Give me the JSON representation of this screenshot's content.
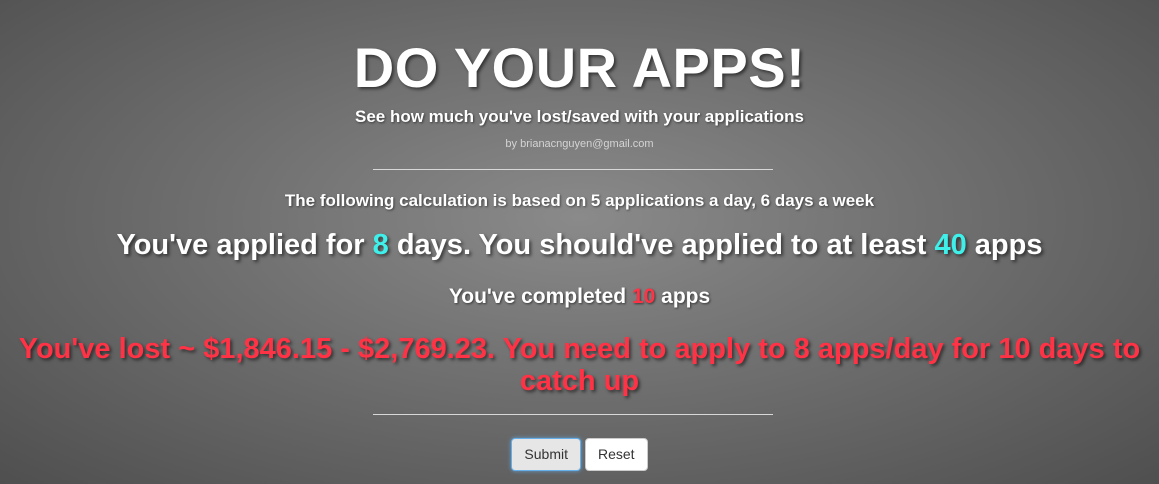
{
  "header": {
    "title": "DO YOUR APPS!",
    "subtitle": "See how much you've lost/saved with your applications",
    "author": "by brianacnguyen@gmail.com"
  },
  "summary": {
    "basis": "The following calculation is based on 5 applications a day, 6 days a week",
    "applied_prefix": "You've applied for ",
    "applied_days": "8",
    "applied_middle": " days. You should've applied to at least ",
    "applied_min_apps": "40",
    "applied_suffix": " apps",
    "completed_prefix": "You've completed ",
    "completed_count": "10",
    "completed_suffix": " apps",
    "lost_message": "You've lost ~ $1,846.15 - $2,769.23. You need to apply to 8 apps/day for 10 days to catch up"
  },
  "buttons": {
    "submit_label": "Submit",
    "reset_label": "Reset"
  },
  "colors": {
    "highlight_cyan": "#3ff0ea",
    "alert_red": "#ff3345",
    "background": "#6f6f6f"
  }
}
